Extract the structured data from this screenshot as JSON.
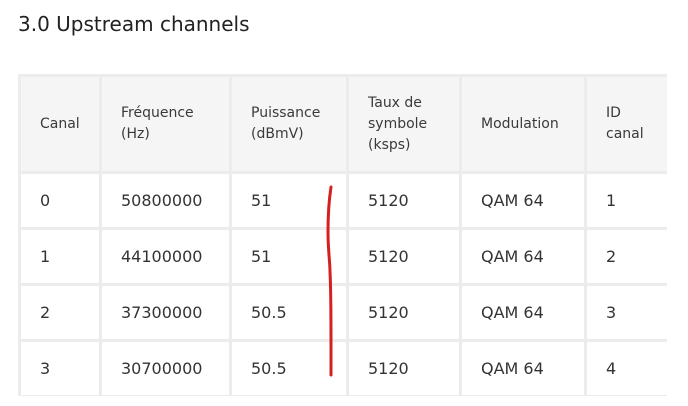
{
  "page": {
    "title": "3.0 Upstream channels"
  },
  "table": {
    "headers": [
      [
        "Canal"
      ],
      [
        "Fréquence",
        "(Hz)"
      ],
      [
        "Puissance",
        "(dBmV)"
      ],
      [
        "Taux de",
        "symbole",
        "(ksps)"
      ],
      [
        "Modulation"
      ],
      [
        "ID",
        "canal"
      ]
    ],
    "rows": [
      [
        "0",
        "50800000",
        "51",
        "5120",
        "QAM 64",
        "1"
      ],
      [
        "1",
        "44100000",
        "51",
        "5120",
        "QAM 64",
        "2"
      ],
      [
        "2",
        "37300000",
        "50.5",
        "5120",
        "QAM 64",
        "3"
      ],
      [
        "3",
        "30700000",
        "50.5",
        "5120",
        "QAM 64",
        "4"
      ]
    ]
  },
  "annotation": {
    "color": "#d42020"
  }
}
